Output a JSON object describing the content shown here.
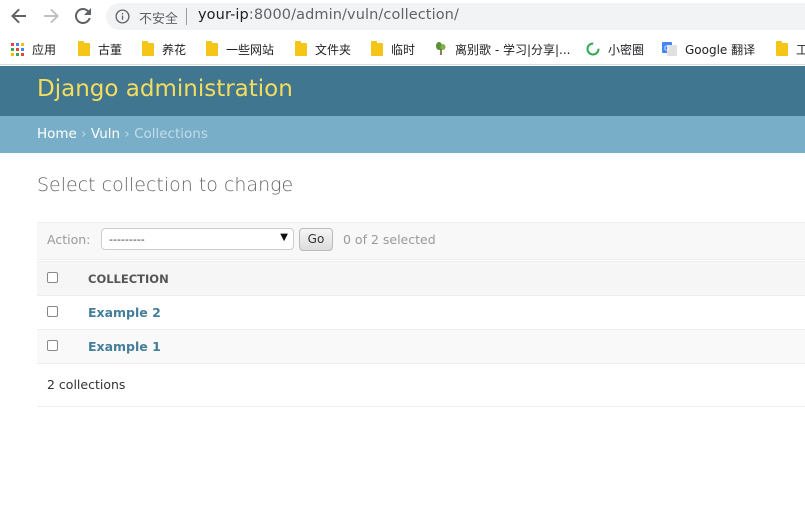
{
  "browser": {
    "security_label": "不安全",
    "url_host": "your-ip",
    "url_path": ":8000/admin/vuln/collection/",
    "bookmarks": [
      {
        "label": "应用",
        "icon": "apps-grid-icon"
      },
      {
        "label": "古董",
        "icon": "folder-icon"
      },
      {
        "label": "养花",
        "icon": "folder-icon"
      },
      {
        "label": "一些网站",
        "icon": "folder-icon"
      },
      {
        "label": "文件夹",
        "icon": "folder-icon"
      },
      {
        "label": "临时",
        "icon": "folder-icon"
      },
      {
        "label": "离别歌 - 学习|分享|...",
        "icon": "plant-icon"
      },
      {
        "label": "小密圈",
        "icon": "circle-logo-icon"
      },
      {
        "label": "Google 翻译",
        "icon": "google-translate-icon"
      },
      {
        "label": "工",
        "icon": "folder-icon"
      }
    ]
  },
  "admin": {
    "site_title": "Django administration",
    "breadcrumbs": {
      "home": "Home",
      "app": "Vuln",
      "current": "Collections",
      "separator": "›"
    },
    "page_title": "Select collection to change",
    "actions": {
      "label": "Action:",
      "selected_option": "---------",
      "go_label": "Go",
      "selection_count": "0 of 2 selected"
    },
    "table": {
      "column_header": "COLLECTION",
      "rows": [
        "Example 2",
        "Example 1"
      ]
    },
    "paginator": "2 collections"
  },
  "colors": {
    "header_bg": "#417690",
    "branding": "#f5dd5d",
    "breadcrumbs_bg": "#79aec8",
    "link": "#447e9b"
  }
}
